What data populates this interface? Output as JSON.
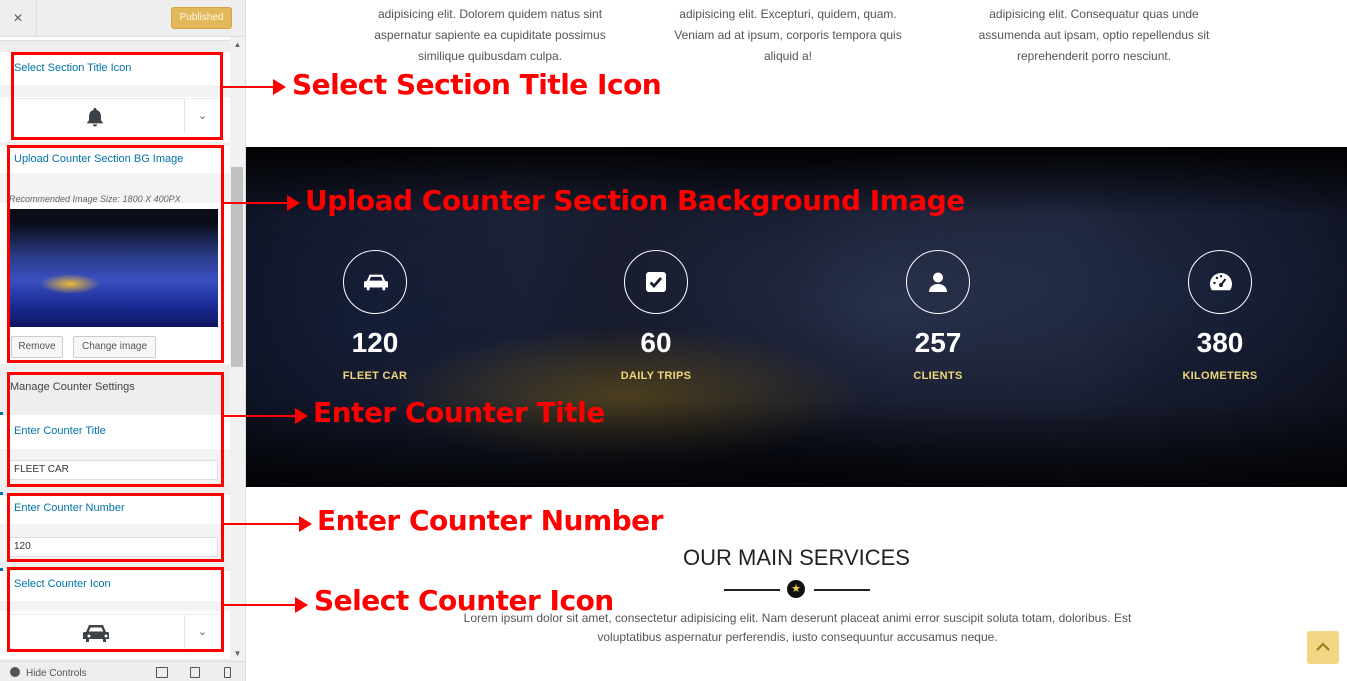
{
  "sidebar": {
    "close_icon": "×",
    "published_label": "Published",
    "fields": {
      "section_title_icon": {
        "title": "Select Section Title Icon",
        "icon": "bell-icon"
      },
      "bg_image": {
        "title": "Upload Counter Section BG Image",
        "recommended": "Recommended Image Size: 1800 X 400PX",
        "remove_label": "Remove",
        "change_label": "Change image"
      },
      "manage_heading": "Manage Counter Settings",
      "counter_title": {
        "title": "Enter Counter Title",
        "value": "FLEET CAR"
      },
      "counter_number": {
        "title": "Enter Counter Number",
        "value": "120"
      },
      "counter_icon": {
        "title": "Select Counter Icon",
        "icon": "car-icon"
      }
    },
    "footer": {
      "hide_controls": "Hide Controls"
    }
  },
  "preview": {
    "blurbs": [
      "adipisicing elit. Dolorem quidem natus sint aspernatur sapiente ea cupiditate possimus similique quibusdam culpa.",
      "adipisicing elit. Excepturi, quidem, quam. Veniam ad at ipsum, corporis tempora quis aliquid a!",
      "adipisicing elit. Consequatur quas unde assumenda aut ipsam, optio repellendus sit reprehenderit porro nesciunt."
    ],
    "counters": [
      {
        "number": "120",
        "label": "FLEET CAR",
        "icon": "car-icon"
      },
      {
        "number": "60",
        "label": "DAILY TRIPS",
        "icon": "check-square-icon"
      },
      {
        "number": "257",
        "label": "CLIENTS",
        "icon": "user-icon"
      },
      {
        "number": "380",
        "label": "KILOMETERS",
        "icon": "speedometer-icon"
      }
    ],
    "services": {
      "title": "OUR MAIN SERVICES",
      "divider_icon": "star-icon",
      "text": "Lorem ipsum dolor sit amet, consectetur adipisicing elit. Nam deserunt placeat animi error suscipit soluta totam, doloribus. Est voluptatibus aspernatur perferendis, iusto consequuntur accusamus neque."
    }
  },
  "annotations": [
    "Select Section Title Icon",
    "Upload Counter Section Background Image",
    "Enter Counter Title",
    "Enter Counter Number",
    "Select Counter Icon"
  ],
  "colors": {
    "annotation": "#ff0000",
    "published_button": "#e3b85a",
    "link_blue": "#0073aa",
    "counter_label": "#f0d77a"
  }
}
